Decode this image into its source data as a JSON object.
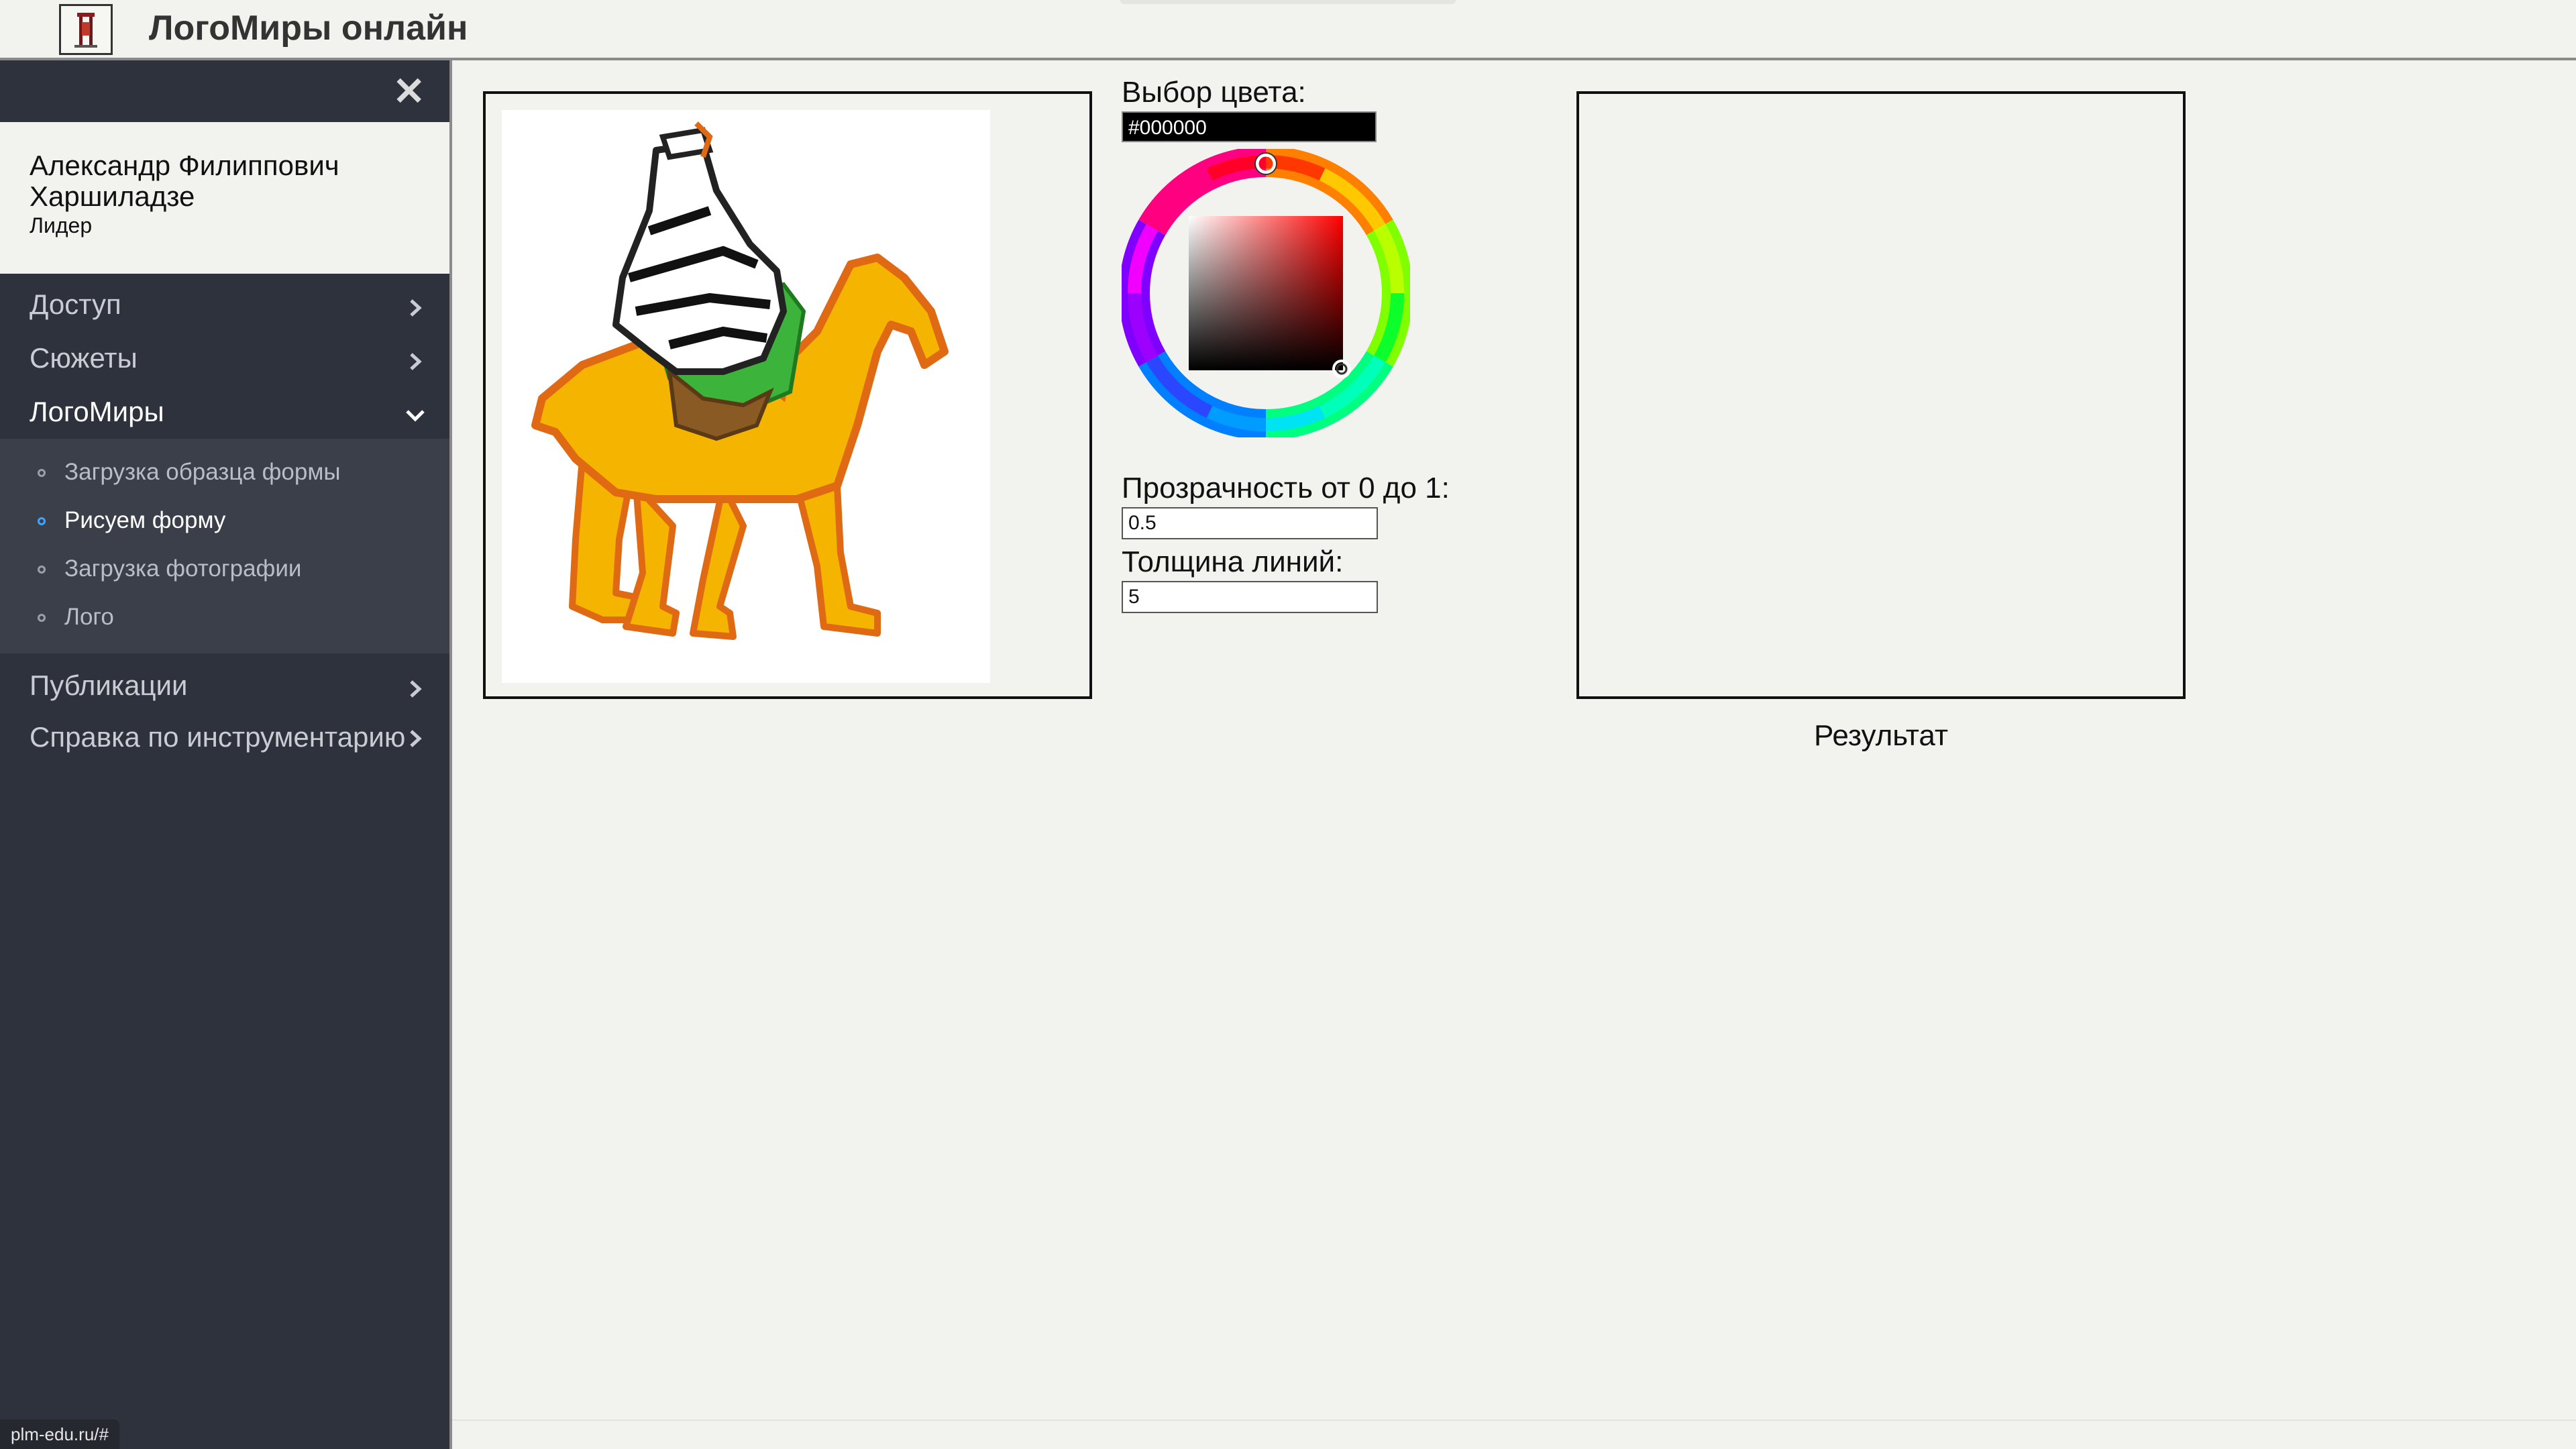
{
  "header": {
    "title": "ЛогоМиры онлайн",
    "logo_icon": "logo-icon"
  },
  "sidebar": {
    "user": {
      "name": "Александр Филиппович Харшиладзе",
      "role": "Лидер"
    },
    "items": [
      {
        "label": "Доступ"
      },
      {
        "label": "Сюжеты"
      },
      {
        "label": "ЛогоМиры",
        "expanded": true
      },
      {
        "label": "Публикации"
      },
      {
        "label": "Справка по инструментарию"
      }
    ],
    "subitems": [
      {
        "label": "Загрузка образца формы"
      },
      {
        "label": "Рисуем форму",
        "active": true
      },
      {
        "label": "Загрузка фотографии"
      },
      {
        "label": "Лого"
      }
    ],
    "status_url": "plm-edu.ru/#"
  },
  "picker": {
    "color_label": "Выбор цвета:",
    "color_value": "#000000",
    "opacity_label": "Прозрачность от 0 до 1:",
    "opacity_value": "0.5",
    "width_label": "Толщина линий:",
    "width_value": "5"
  },
  "result": {
    "label": "Результат"
  },
  "colors": {
    "sidebar_bg": "#2d323c",
    "submenu_bg": "#3a3f49",
    "page_bg": "#f2f2ee",
    "active_dot": "#3aa6ff",
    "camel_body": "#f5b400",
    "camel_outline": "#e06a14",
    "saddle_green": "#3cb43c"
  }
}
